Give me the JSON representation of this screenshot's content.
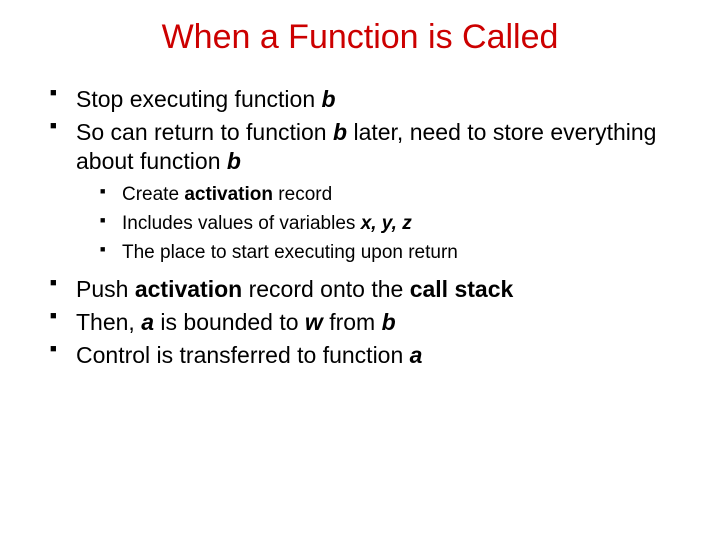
{
  "title": "When a Function is Called",
  "bullets": {
    "a1_pre": "Stop executing function ",
    "a1_em": "b",
    "a2_pre": "So can return to function ",
    "a2_em1": "b",
    "a2_mid": " later, need to store everything about function ",
    "a2_em2": "b",
    "b1_pre": "Create ",
    "b1_bold": "activation",
    "b1_post": " record",
    "b2_pre": "Includes values of variables ",
    "b2_em": "x, y, z",
    "b3": "The place to start executing upon return",
    "a3_pre": "Push ",
    "a3_bold1": "activation",
    "a3_mid": " record onto the ",
    "a3_bold2": "call stack",
    "a4_pre": "Then, ",
    "a4_em1": "a",
    "a4_mid1": " is bounded to ",
    "a4_em2": "w",
    "a4_mid2": " from ",
    "a4_em3": "b",
    "a5_pre": "Control is transferred to function ",
    "a5_em": "a"
  }
}
